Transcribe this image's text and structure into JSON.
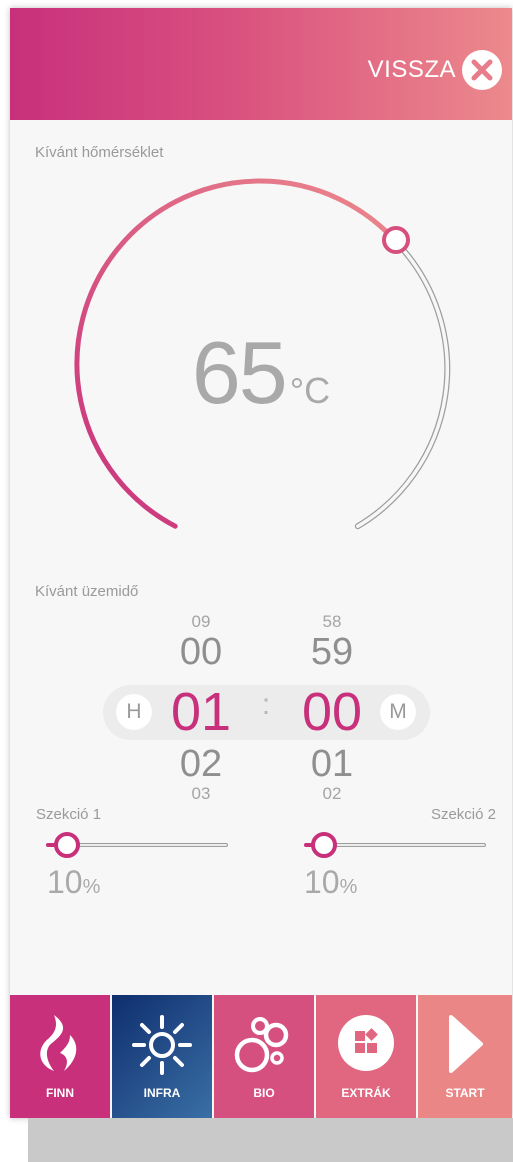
{
  "header": {
    "back_label": "VISSZA"
  },
  "temperature": {
    "label": "Kívánt hőmérséklet",
    "value": "65",
    "unit": "°C"
  },
  "runtime": {
    "label": "Kívánt üzemidő",
    "hours": {
      "badge": "H",
      "above2": "09",
      "above1": "00",
      "selected": "01",
      "below1": "02",
      "below2": "03"
    },
    "separator": ":",
    "minutes": {
      "badge": "M",
      "above2": "58",
      "above1": "59",
      "selected": "00",
      "below1": "01",
      "below2": "02"
    }
  },
  "sections": [
    {
      "label": "Szekció 1",
      "value": "10",
      "unit": "%"
    },
    {
      "label": "Szekció 2",
      "value": "10",
      "unit": "%"
    }
  ],
  "tabs": [
    {
      "label": "FINN",
      "icon": "flame-icon",
      "color": "#c8307c"
    },
    {
      "label": "INFRA",
      "icon": "sun-icon",
      "color": "#1f4a8a"
    },
    {
      "label": "BIO",
      "icon": "bubbles-icon",
      "color": "#d6507f"
    },
    {
      "label": "EXTRÁK",
      "icon": "extras-icon",
      "color": "#e0677f"
    },
    {
      "label": "START",
      "icon": "play-icon",
      "color": "#eb8687"
    }
  ],
  "colors": {
    "accent": "#c8307c",
    "header_end": "#ec8a8c"
  }
}
